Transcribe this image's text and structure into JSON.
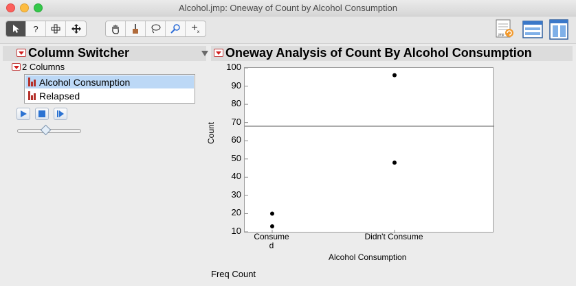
{
  "window": {
    "title": "Alcohol.jmp: Oneway of Count by Alcohol Consumption"
  },
  "toolbar": {
    "tools": [
      "arrow-icon",
      "help-icon",
      "crosshair-icon",
      "move-icon",
      "hand-icon",
      "brush-icon",
      "lasso-icon",
      "magnifier-icon",
      "annotate-icon"
    ],
    "right_icons": [
      "data-table-icon",
      "window-layout-icon",
      "panel-layout-icon"
    ]
  },
  "column_switcher": {
    "title": "Column Switcher",
    "count_label": "2 Columns",
    "columns": [
      {
        "label": "Alcohol Consumption",
        "selected": true
      },
      {
        "label": "Relapsed",
        "selected": false
      }
    ],
    "controls": [
      "play-icon",
      "stop-icon",
      "step-icon"
    ],
    "slider_level": 0.45
  },
  "oneway": {
    "title": "Oneway Analysis of Count By Alcohol Consumption",
    "freq_label": "Freq Count"
  },
  "chart_data": {
    "type": "scatter",
    "title": "",
    "xlabel": "Alcohol Consumption",
    "ylabel": "Count",
    "categories": [
      "Consumed",
      "Didn't Consume"
    ],
    "category_labels": [
      [
        "Consume",
        "d"
      ],
      [
        "Didn't Consume"
      ]
    ],
    "ylim": [
      10,
      100
    ],
    "yticks": [
      10,
      20,
      30,
      40,
      50,
      60,
      70,
      80,
      90,
      100
    ],
    "grid": false,
    "points": [
      {
        "x": "Consumed",
        "y": 20
      },
      {
        "x": "Consumed",
        "y": 13
      },
      {
        "x": "Didn't Consume",
        "y": 96
      },
      {
        "x": "Didn't Consume",
        "y": 48
      }
    ],
    "mean_line": 68
  }
}
